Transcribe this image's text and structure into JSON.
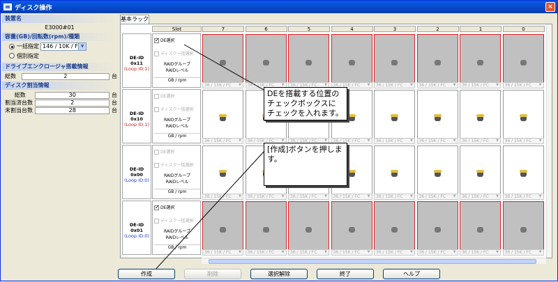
{
  "window": {
    "title": "ディスク操作",
    "close": "×"
  },
  "left": {
    "device_header": "装置名",
    "device_name": "E3000#01",
    "capacity_header": "容量(GB)/回転数(rpm)/種類",
    "radio_batch": "一括指定",
    "radio_individual": "個別指定",
    "capacity_select": "146 / 10K / FC",
    "de_header": "ドライブエンクロージャ搭載情報",
    "de_total_label": "総数",
    "de_total_value": "2",
    "de_unit": "台",
    "alloc_header": "ディスク割当情報",
    "alloc_rows": [
      {
        "label": "総数",
        "value": "30",
        "unit": "台"
      },
      {
        "label": "割当済台数",
        "value": "2",
        "unit": "台"
      },
      {
        "label": "未割当台数",
        "value": "28",
        "unit": "台"
      }
    ]
  },
  "tab": {
    "label": "基本ラック"
  },
  "rack": {
    "slot_header": "Slot",
    "slots": [
      "7",
      "6",
      "5",
      "4",
      "3",
      "2",
      "1",
      "0"
    ],
    "rows": [
      {
        "id": "DE-ID 0x11",
        "loop": "(Loop ID:1)",
        "de_select": "DE選択",
        "disk_select": "ディスク一括選択",
        "raid_group": "RAIDグループ",
        "raid_level": "RAIDレベル",
        "gb_rpm": "GB / rpm",
        "checked": true,
        "filled": true
      },
      {
        "id": "DE-ID 0x10",
        "loop": "(Loop ID:1)",
        "de_select": "DE選択",
        "disk_select": "ディスク一括選択",
        "raid_group": "RAIDグループ",
        "raid_level": "RAIDレベル",
        "gb_rpm": "GB / rpm",
        "checked": false,
        "filled": false
      },
      {
        "id": "DE-ID 0x00",
        "loop": "(Loop ID:0)",
        "de_select": "DE選択",
        "disk_select": "ディスク一括選択",
        "raid_group": "RAIDグループ",
        "raid_level": "RAIDレベル",
        "gb_rpm": "GB / rpm",
        "checked": false,
        "filled": false
      },
      {
        "id": "DE-ID 0x01",
        "loop": "(Loop ID:0)",
        "de_select": "DE選択",
        "disk_select": "ディスク一括選択",
        "raid_group": "RAIDグループ",
        "raid_level": "RAIDレベル",
        "gb_rpm": "GB / rpm",
        "checked": true,
        "filled": true
      }
    ],
    "disk_size_label": "36 / 15K / FC"
  },
  "callouts": {
    "de_check": "DEを搭載する位置の\nチェックボックスに\nチェックを入れます。",
    "create": "[作成]ボタンを押しま\nす。"
  },
  "buttons": {
    "create": "作成",
    "delete": "削除",
    "clear": "選択解除",
    "end": "終了",
    "help": "ヘルプ"
  },
  "colors": {
    "title_blue": "#0747c7",
    "selected_border": "#e02020",
    "disk_gray": "#c0c0c0"
  }
}
